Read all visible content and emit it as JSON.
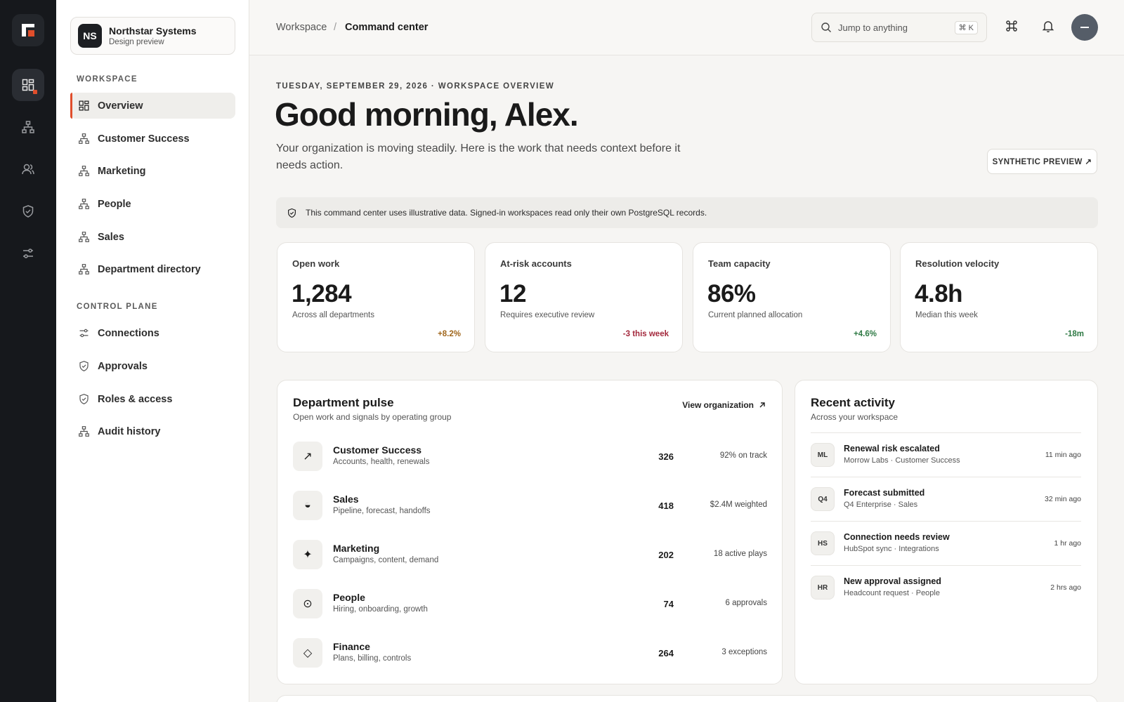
{
  "org": {
    "initials": "NS",
    "name": "Northstar Systems",
    "subtitle": "Design preview"
  },
  "sidebar": {
    "workspace_label": "WORKSPACE",
    "workspace_items": [
      {
        "label": "Overview",
        "icon": "grid-icon",
        "active": true
      },
      {
        "label": "Customer Success",
        "icon": "org-chart-icon"
      },
      {
        "label": "Marketing",
        "icon": "org-chart-icon"
      },
      {
        "label": "People",
        "icon": "org-chart-icon"
      },
      {
        "label": "Sales",
        "icon": "org-chart-icon"
      },
      {
        "label": "Department directory",
        "icon": "org-chart-icon"
      }
    ],
    "control_label": "CONTROL PLANE",
    "control_items": [
      {
        "label": "Connections",
        "icon": "sliders-icon"
      },
      {
        "label": "Approvals",
        "icon": "shield-check-icon"
      },
      {
        "label": "Roles & access",
        "icon": "shield-check-icon"
      },
      {
        "label": "Audit history",
        "icon": "org-chart-icon"
      }
    ]
  },
  "rail": {
    "icons": [
      "app-logo-icon",
      "grid-icon",
      "org-chart-icon",
      "users-icon",
      "shield-check-icon",
      "sliders-icon"
    ]
  },
  "header": {
    "breadcrumb_root": "Workspace",
    "breadcrumb_sep": "/",
    "breadcrumb_current": "Command center",
    "search_placeholder": "Jump to anything",
    "search_shortcut": "⌘ K"
  },
  "hero": {
    "eyebrow": "TUESDAY, SEPTEMBER 29, 2026 · WORKSPACE OVERVIEW",
    "greeting": "Good morning, Alex.",
    "lead": "Your organization is moving steadily. Here is the work that needs context before it needs action.",
    "preview_button": "SYNTHETIC PREVIEW ↗"
  },
  "notice": "This command center uses illustrative data. Signed-in workspaces read only their own PostgreSQL records.",
  "stats": [
    {
      "label": "Open work",
      "value": "1,284",
      "sub": "Across all departments",
      "delta": "+8.2%",
      "delta_color": "#a0661b"
    },
    {
      "label": "At-risk accounts",
      "value": "12",
      "sub": "Requires executive review",
      "delta": "-3 this week",
      "delta_color": "#a3283c"
    },
    {
      "label": "Team capacity",
      "value": "86%",
      "sub": "Current planned allocation",
      "delta": "+4.6%",
      "delta_color": "#2f7a45"
    },
    {
      "label": "Resolution velocity",
      "value": "4.8h",
      "sub": "Median this week",
      "delta": "-18m",
      "delta_color": "#2f7a45"
    }
  ],
  "pulse": {
    "title": "Department pulse",
    "subtitle": "Open work and signals by operating group",
    "link": "View organization",
    "rows": [
      {
        "icon": "↗",
        "icon_name": "arrow-up-right-icon",
        "name": "Customer Success",
        "desc": "Accounts, health, renewals",
        "count": "326",
        "signal": "92% on track"
      },
      {
        "icon": "◒",
        "icon_name": "half-circle-icon",
        "name": "Sales",
        "desc": "Pipeline, forecast, handoffs",
        "count": "418",
        "signal": "$2.4M weighted"
      },
      {
        "icon": "✦",
        "icon_name": "sparkle-icon",
        "name": "Marketing",
        "desc": "Campaigns, content, demand",
        "count": "202",
        "signal": "18 active plays"
      },
      {
        "icon": "⊙",
        "icon_name": "target-icon",
        "name": "People",
        "desc": "Hiring, onboarding, growth",
        "count": "74",
        "signal": "6 approvals"
      },
      {
        "icon": "◇",
        "icon_name": "diamond-icon",
        "name": "Finance",
        "desc": "Plans, billing, controls",
        "count": "264",
        "signal": "3 exceptions"
      }
    ]
  },
  "activity": {
    "title": "Recent activity",
    "subtitle": "Across your workspace",
    "items": [
      {
        "badge": "ML",
        "title": "Renewal risk escalated",
        "sub": "Morrow Labs · Customer Success",
        "time": "11 min ago"
      },
      {
        "badge": "Q4",
        "title": "Forecast submitted",
        "sub": "Q4 Enterprise · Sales",
        "time": "32 min ago"
      },
      {
        "badge": "HS",
        "title": "Connection needs review",
        "sub": "HubSpot sync · Integrations",
        "time": "1 hr ago"
      },
      {
        "badge": "HR",
        "title": "New approval assigned",
        "sub": "Headcount request · People",
        "time": "2 hrs ago"
      }
    ]
  },
  "colors": {
    "accent": "#e04e2b",
    "rail": "#16181c"
  }
}
